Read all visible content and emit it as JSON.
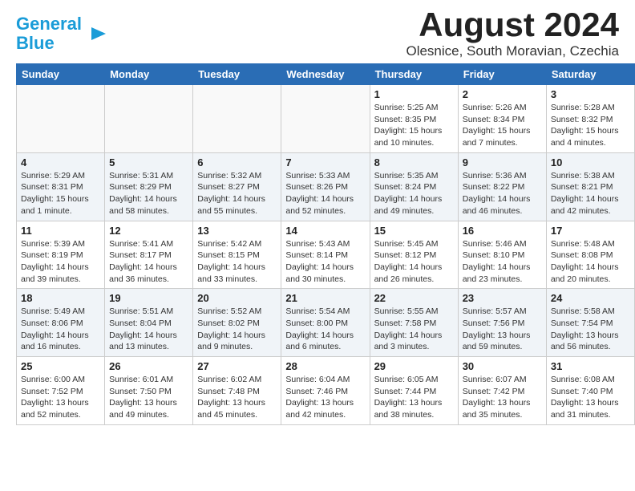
{
  "header": {
    "logo_line1": "General",
    "logo_line2": "Blue",
    "month_year": "August 2024",
    "location": "Olesnice, South Moravian, Czechia"
  },
  "weekdays": [
    "Sunday",
    "Monday",
    "Tuesday",
    "Wednesday",
    "Thursday",
    "Friday",
    "Saturday"
  ],
  "weeks": [
    [
      {
        "day": "",
        "info": ""
      },
      {
        "day": "",
        "info": ""
      },
      {
        "day": "",
        "info": ""
      },
      {
        "day": "",
        "info": ""
      },
      {
        "day": "1",
        "info": "Sunrise: 5:25 AM\nSunset: 8:35 PM\nDaylight: 15 hours\nand 10 minutes."
      },
      {
        "day": "2",
        "info": "Sunrise: 5:26 AM\nSunset: 8:34 PM\nDaylight: 15 hours\nand 7 minutes."
      },
      {
        "day": "3",
        "info": "Sunrise: 5:28 AM\nSunset: 8:32 PM\nDaylight: 15 hours\nand 4 minutes."
      }
    ],
    [
      {
        "day": "4",
        "info": "Sunrise: 5:29 AM\nSunset: 8:31 PM\nDaylight: 15 hours\nand 1 minute."
      },
      {
        "day": "5",
        "info": "Sunrise: 5:31 AM\nSunset: 8:29 PM\nDaylight: 14 hours\nand 58 minutes."
      },
      {
        "day": "6",
        "info": "Sunrise: 5:32 AM\nSunset: 8:27 PM\nDaylight: 14 hours\nand 55 minutes."
      },
      {
        "day": "7",
        "info": "Sunrise: 5:33 AM\nSunset: 8:26 PM\nDaylight: 14 hours\nand 52 minutes."
      },
      {
        "day": "8",
        "info": "Sunrise: 5:35 AM\nSunset: 8:24 PM\nDaylight: 14 hours\nand 49 minutes."
      },
      {
        "day": "9",
        "info": "Sunrise: 5:36 AM\nSunset: 8:22 PM\nDaylight: 14 hours\nand 46 minutes."
      },
      {
        "day": "10",
        "info": "Sunrise: 5:38 AM\nSunset: 8:21 PM\nDaylight: 14 hours\nand 42 minutes."
      }
    ],
    [
      {
        "day": "11",
        "info": "Sunrise: 5:39 AM\nSunset: 8:19 PM\nDaylight: 14 hours\nand 39 minutes."
      },
      {
        "day": "12",
        "info": "Sunrise: 5:41 AM\nSunset: 8:17 PM\nDaylight: 14 hours\nand 36 minutes."
      },
      {
        "day": "13",
        "info": "Sunrise: 5:42 AM\nSunset: 8:15 PM\nDaylight: 14 hours\nand 33 minutes."
      },
      {
        "day": "14",
        "info": "Sunrise: 5:43 AM\nSunset: 8:14 PM\nDaylight: 14 hours\nand 30 minutes."
      },
      {
        "day": "15",
        "info": "Sunrise: 5:45 AM\nSunset: 8:12 PM\nDaylight: 14 hours\nand 26 minutes."
      },
      {
        "day": "16",
        "info": "Sunrise: 5:46 AM\nSunset: 8:10 PM\nDaylight: 14 hours\nand 23 minutes."
      },
      {
        "day": "17",
        "info": "Sunrise: 5:48 AM\nSunset: 8:08 PM\nDaylight: 14 hours\nand 20 minutes."
      }
    ],
    [
      {
        "day": "18",
        "info": "Sunrise: 5:49 AM\nSunset: 8:06 PM\nDaylight: 14 hours\nand 16 minutes."
      },
      {
        "day": "19",
        "info": "Sunrise: 5:51 AM\nSunset: 8:04 PM\nDaylight: 14 hours\nand 13 minutes."
      },
      {
        "day": "20",
        "info": "Sunrise: 5:52 AM\nSunset: 8:02 PM\nDaylight: 14 hours\nand 9 minutes."
      },
      {
        "day": "21",
        "info": "Sunrise: 5:54 AM\nSunset: 8:00 PM\nDaylight: 14 hours\nand 6 minutes."
      },
      {
        "day": "22",
        "info": "Sunrise: 5:55 AM\nSunset: 7:58 PM\nDaylight: 14 hours\nand 3 minutes."
      },
      {
        "day": "23",
        "info": "Sunrise: 5:57 AM\nSunset: 7:56 PM\nDaylight: 13 hours\nand 59 minutes."
      },
      {
        "day": "24",
        "info": "Sunrise: 5:58 AM\nSunset: 7:54 PM\nDaylight: 13 hours\nand 56 minutes."
      }
    ],
    [
      {
        "day": "25",
        "info": "Sunrise: 6:00 AM\nSunset: 7:52 PM\nDaylight: 13 hours\nand 52 minutes."
      },
      {
        "day": "26",
        "info": "Sunrise: 6:01 AM\nSunset: 7:50 PM\nDaylight: 13 hours\nand 49 minutes."
      },
      {
        "day": "27",
        "info": "Sunrise: 6:02 AM\nSunset: 7:48 PM\nDaylight: 13 hours\nand 45 minutes."
      },
      {
        "day": "28",
        "info": "Sunrise: 6:04 AM\nSunset: 7:46 PM\nDaylight: 13 hours\nand 42 minutes."
      },
      {
        "day": "29",
        "info": "Sunrise: 6:05 AM\nSunset: 7:44 PM\nDaylight: 13 hours\nand 38 minutes."
      },
      {
        "day": "30",
        "info": "Sunrise: 6:07 AM\nSunset: 7:42 PM\nDaylight: 13 hours\nand 35 minutes."
      },
      {
        "day": "31",
        "info": "Sunrise: 6:08 AM\nSunset: 7:40 PM\nDaylight: 13 hours\nand 31 minutes."
      }
    ]
  ]
}
